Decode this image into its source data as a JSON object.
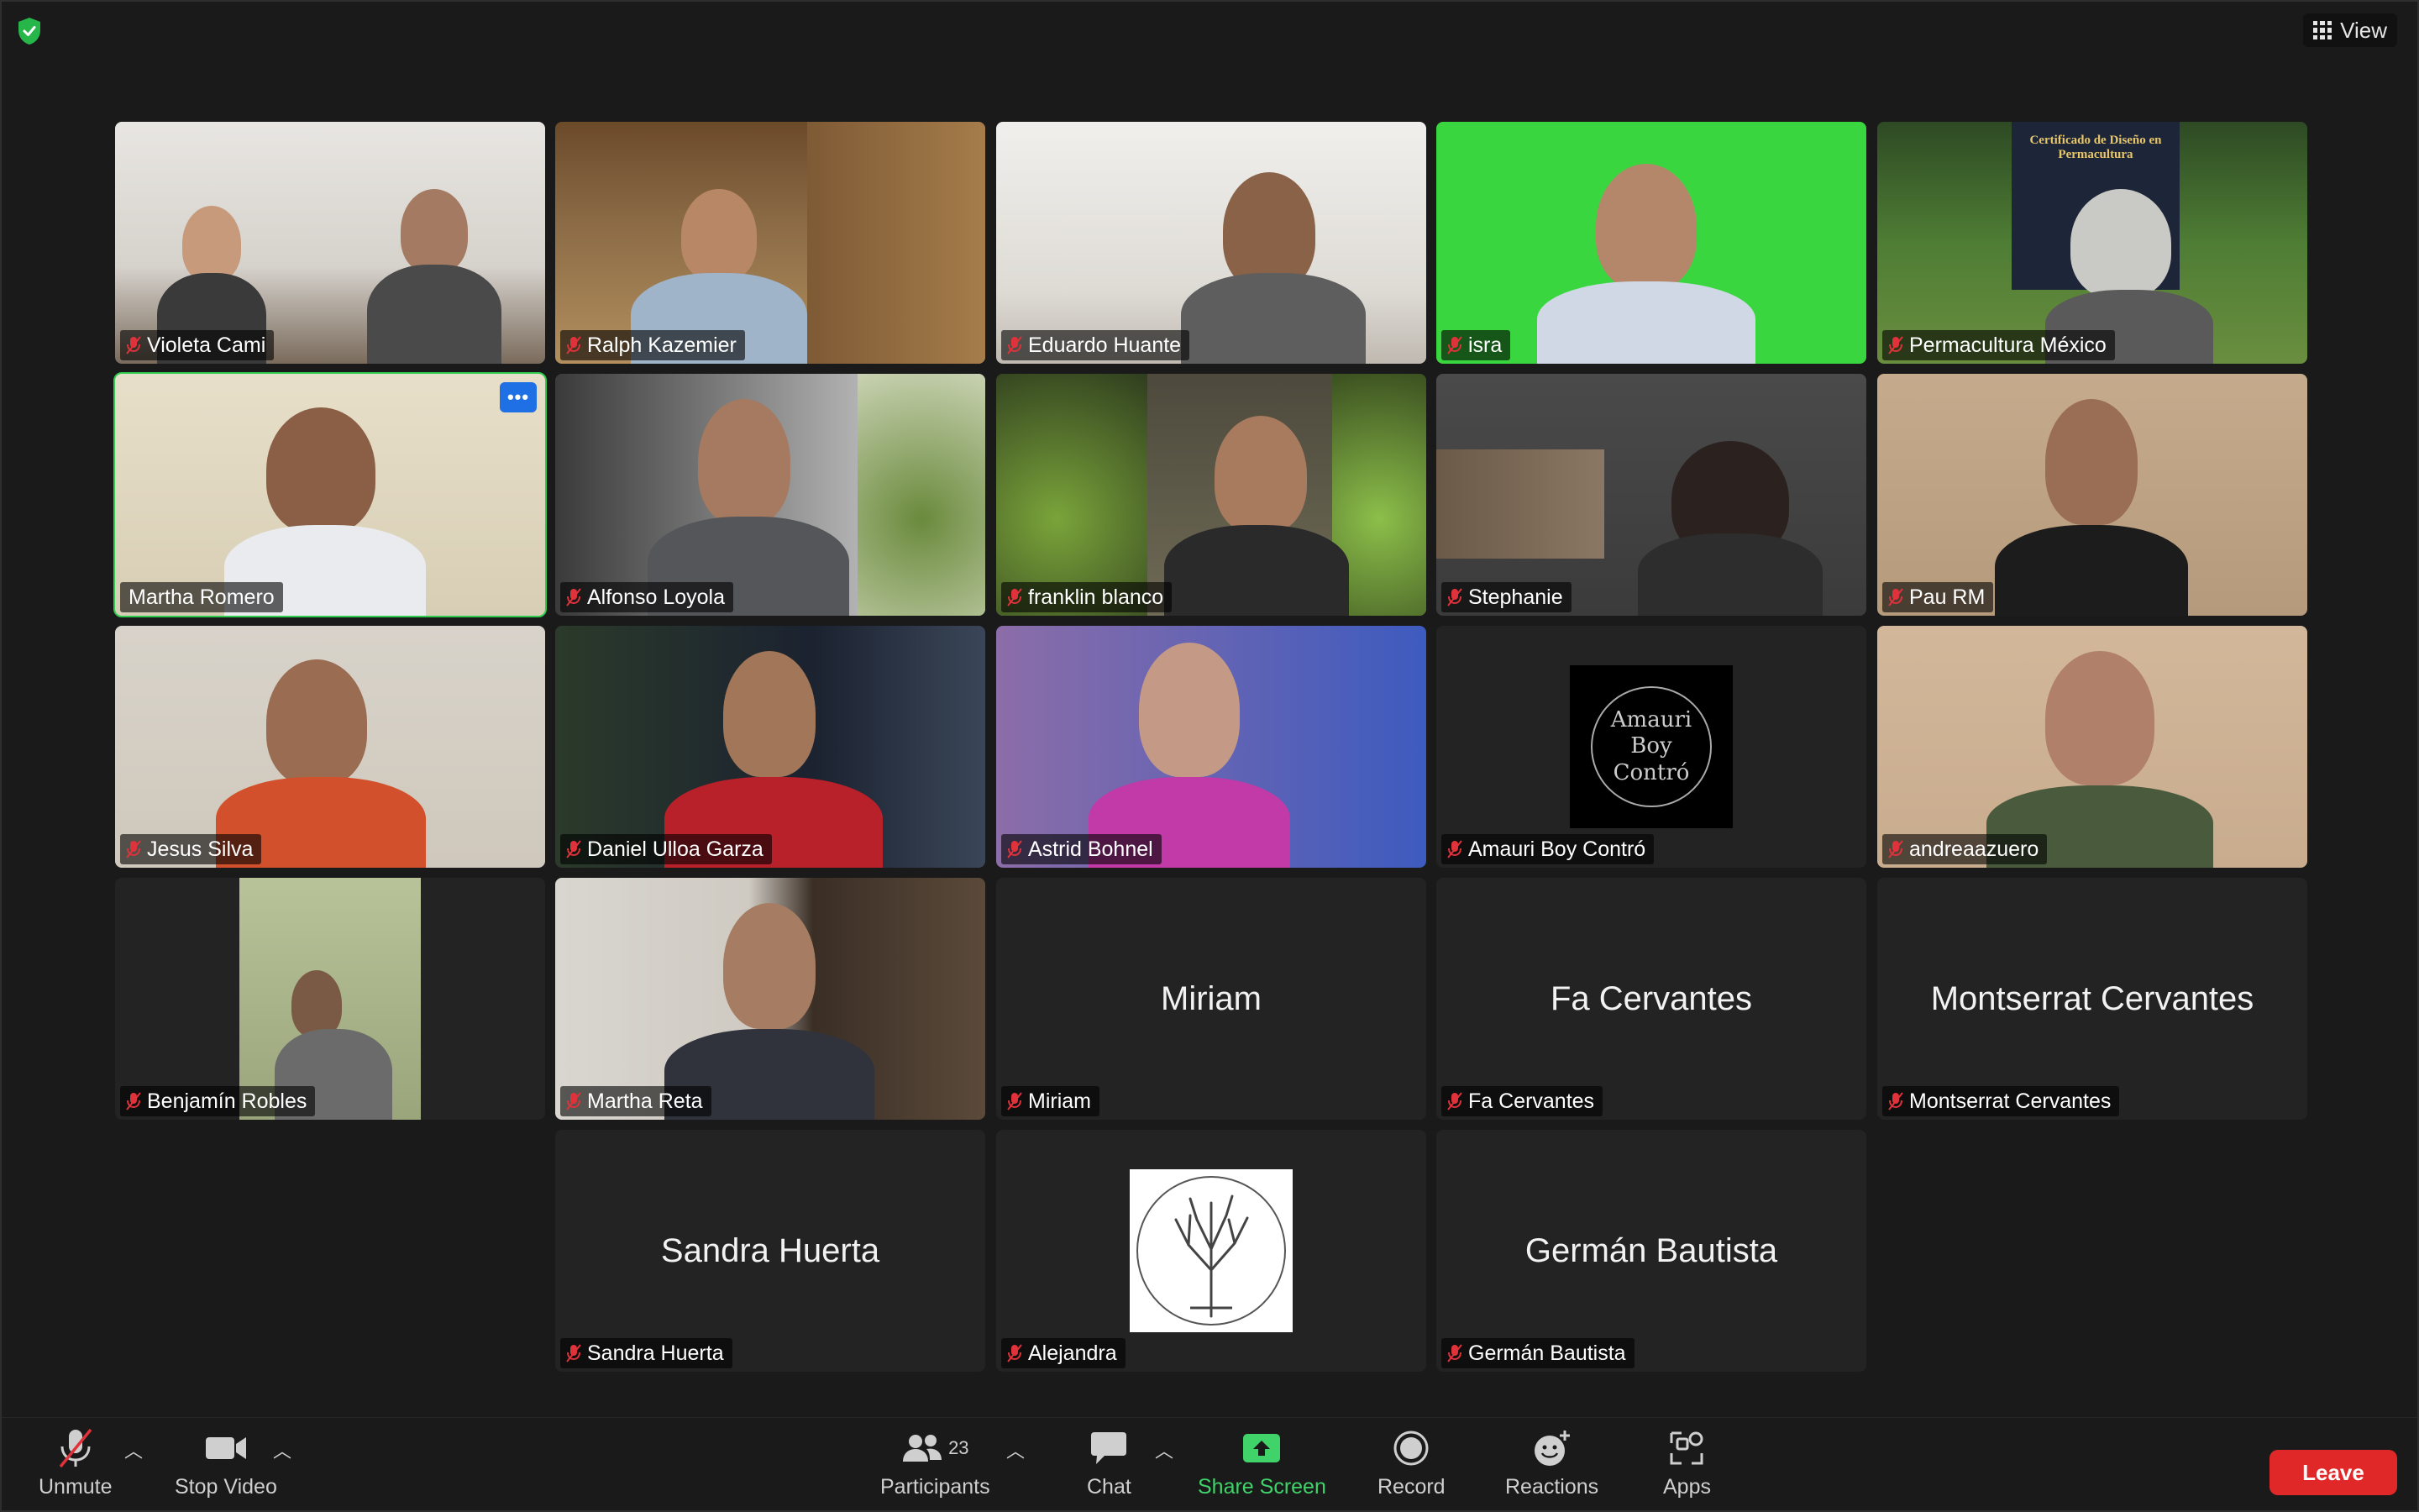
{
  "top": {
    "view_label": "View"
  },
  "participants": [
    {
      "name": "Violeta Cami",
      "type": "video"
    },
    {
      "name": "Ralph Kazemier",
      "type": "video"
    },
    {
      "name": "Eduardo Huante",
      "type": "video"
    },
    {
      "name": "isra",
      "type": "video"
    },
    {
      "name": "Permacultura México",
      "type": "video"
    },
    {
      "name": "Martha Romero",
      "type": "video",
      "active_speaker": true
    },
    {
      "name": "Alfonso Loyola",
      "type": "video"
    },
    {
      "name": "franklin blanco",
      "type": "video"
    },
    {
      "name": "Stephanie",
      "type": "video"
    },
    {
      "name": "Pau RM",
      "type": "video"
    },
    {
      "name": "Jesus Silva",
      "type": "video"
    },
    {
      "name": "Daniel Ulloa Garza",
      "type": "video"
    },
    {
      "name": "Astrid Bohnel",
      "type": "video"
    },
    {
      "name": "Amauri Boy Contró",
      "type": "avatar",
      "avatar_text": "Amauri Boy Contró"
    },
    {
      "name": "andreaazuero",
      "type": "video"
    },
    {
      "name": "Benjamín Robles",
      "type": "video"
    },
    {
      "name": "Martha Reta",
      "type": "video"
    },
    {
      "name": "Miriam",
      "type": "name"
    },
    {
      "name": "Fa Cervantes",
      "type": "name"
    },
    {
      "name": "Montserrat Cervantes",
      "type": "name"
    },
    {
      "name": "Sandra Huerta",
      "type": "name"
    },
    {
      "name": "Alejandra",
      "type": "avatar-tree"
    },
    {
      "name": "Germán Bautista",
      "type": "name"
    }
  ],
  "permacultura_banner": "Certificado de Diseño en Permacultura",
  "toolbar": {
    "unmute": "Unmute",
    "stop_video": "Stop Video",
    "participants": "Participants",
    "participants_count": "23",
    "chat": "Chat",
    "share_screen": "Share Screen",
    "record": "Record",
    "reactions": "Reactions",
    "apps": "Apps",
    "leave": "Leave"
  },
  "colors": {
    "active_speaker": "#2fcb4f",
    "share_green": "#3fd36a",
    "leave_red": "#e02828",
    "mute_red": "#e0323a",
    "more_blue": "#1f6fe5"
  }
}
